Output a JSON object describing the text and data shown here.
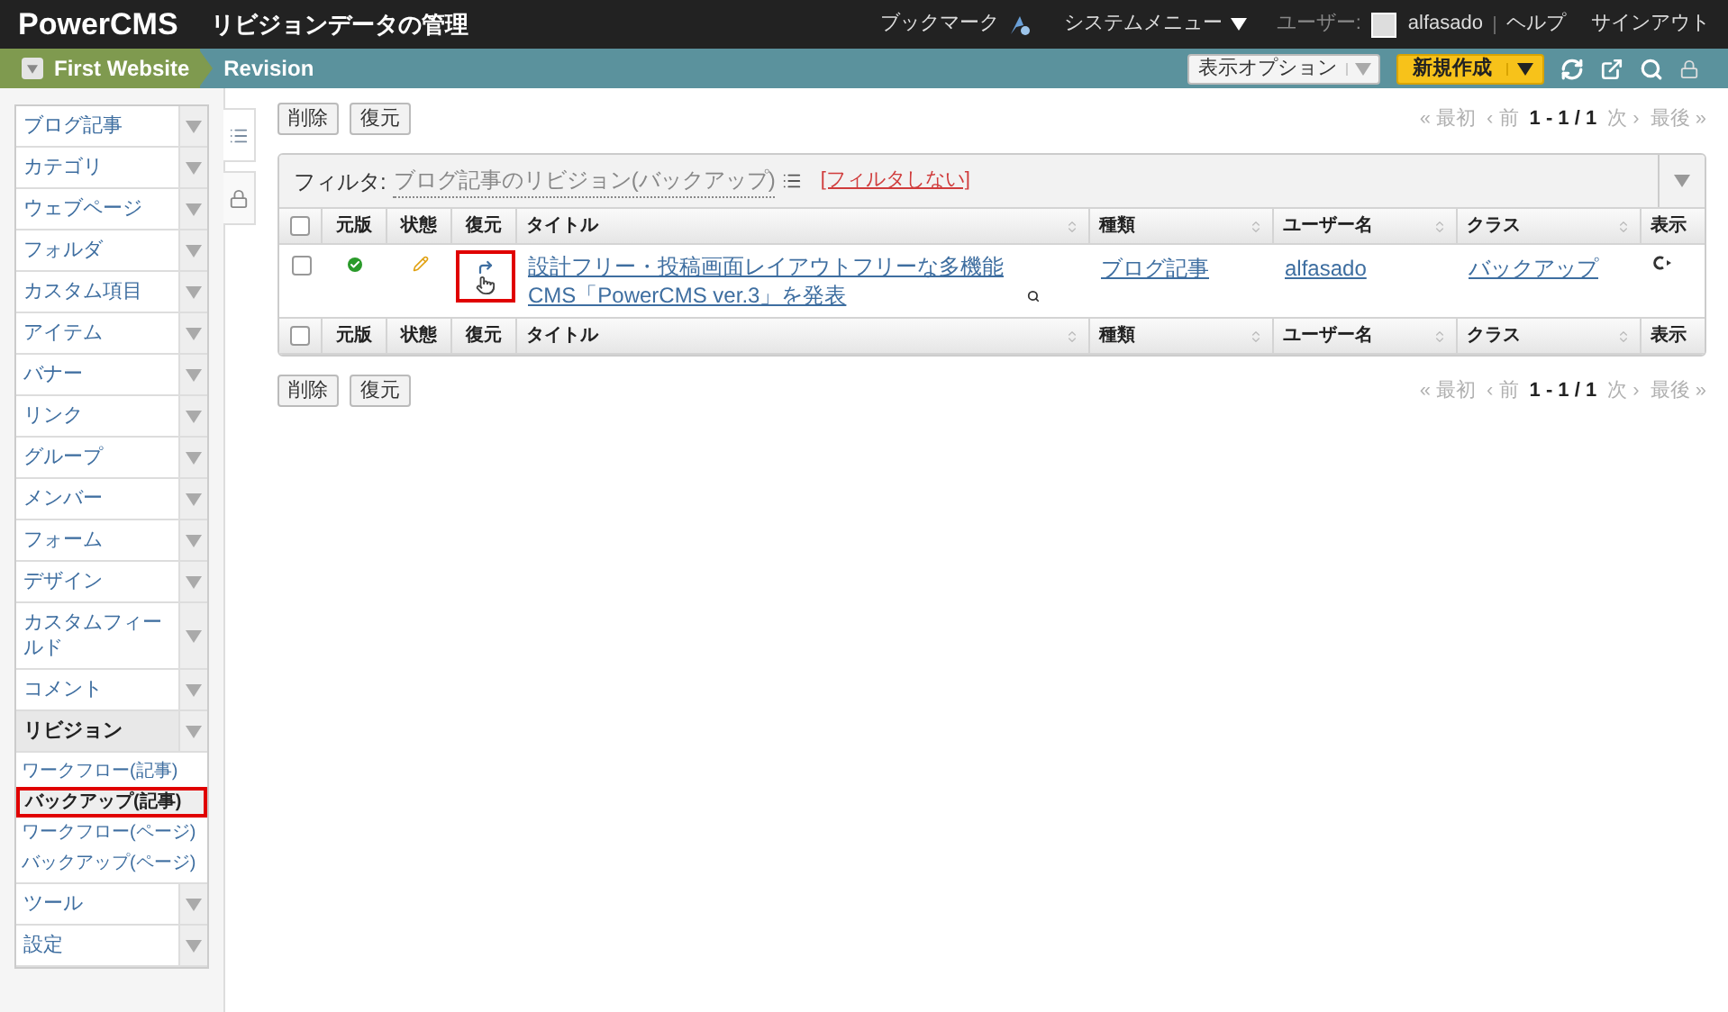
{
  "header": {
    "logo": "PowerCMS",
    "title": "リビジョンデータの管理",
    "bookmark": "ブックマーク",
    "system_menu": "システムメニュー",
    "user_label": "ユーザー:",
    "user": "alfasado",
    "help": "ヘルプ",
    "signout": "サインアウト"
  },
  "breadcrumb": {
    "site": "First Website",
    "page": "Revision"
  },
  "toolbar": {
    "display_options": "表示オプション",
    "new": "新規作成"
  },
  "sidebar": {
    "items": [
      {
        "label": "ブログ記事",
        "expanded": false
      },
      {
        "label": "カテゴリ",
        "expanded": false
      },
      {
        "label": "ウェブページ",
        "expanded": false
      },
      {
        "label": "フォルダ",
        "expanded": false
      },
      {
        "label": "カスタム項目",
        "expanded": false
      },
      {
        "label": "アイテム",
        "expanded": false
      },
      {
        "label": "バナー",
        "expanded": false
      },
      {
        "label": "リンク",
        "expanded": false
      },
      {
        "label": "グループ",
        "expanded": false
      },
      {
        "label": "メンバー",
        "expanded": false
      },
      {
        "label": "フォーム",
        "expanded": false
      },
      {
        "label": "デザイン",
        "expanded": false
      },
      {
        "label": "カスタムフィールド",
        "expanded": false
      },
      {
        "label": "コメント",
        "expanded": false
      },
      {
        "label": "リビジョン",
        "expanded": true,
        "children": [
          {
            "label": "ワークフロー(記事)",
            "selected": false
          },
          {
            "label": "バックアップ(記事)",
            "selected": true
          },
          {
            "label": "ワークフロー(ページ)",
            "selected": false
          },
          {
            "label": "バックアップ(ページ)",
            "selected": false
          }
        ]
      },
      {
        "label": "ツール",
        "expanded": false
      },
      {
        "label": "設定",
        "expanded": false
      }
    ]
  },
  "actions_top": [
    "削除",
    "復元"
  ],
  "pagination_top": {
    "first": "« 最初",
    "prev": "‹ 前",
    "range": "1 - 1 / 1",
    "next": "次 ›",
    "last": "最後 »"
  },
  "filter": {
    "label": "フィルタ:",
    "value": "ブログ記事のリビジョン(バックアップ)",
    "clear": "[フィルタしない]"
  },
  "table": {
    "columns": [
      {
        "kind": "check",
        "checked": false
      },
      {
        "kind": "center",
        "label": "元版"
      },
      {
        "kind": "center",
        "label": "状態"
      },
      {
        "kind": "center",
        "label": "復元"
      },
      {
        "kind": "sort",
        "label": "タイトル"
      },
      {
        "kind": "sort",
        "label": "種類"
      },
      {
        "kind": "sort",
        "label": "ユーザー名"
      },
      {
        "kind": "sort",
        "label": "クラス"
      },
      {
        "kind": "plain",
        "label": "表示"
      }
    ],
    "rows": [
      {
        "checked": false,
        "title": "設計フリー・投稿画面レイアウトフリーな多機能CMS「PowerCMS ver.3」を発表",
        "type": "ブログ記事",
        "user": "alfasado",
        "class": "バックアップ",
        "restore_highlighted": true
      }
    ],
    "footer_columns": [
      {
        "kind": "check",
        "checked": false
      },
      {
        "kind": "center",
        "label": "元版"
      },
      {
        "kind": "center",
        "label": "状態"
      },
      {
        "kind": "center",
        "label": "復元"
      },
      {
        "kind": "sort",
        "label": "タイトル"
      },
      {
        "kind": "sort",
        "label": "種類"
      },
      {
        "kind": "sort",
        "label": "ユーザー名"
      },
      {
        "kind": "sort",
        "label": "クラス"
      },
      {
        "kind": "plain",
        "label": "表示"
      }
    ]
  },
  "actions_bottom": [
    "削除",
    "復元"
  ],
  "pagination_bottom": {
    "first": "« 最初",
    "prev": "‹ 前",
    "range": "1 - 1 / 1",
    "next": "次 ›",
    "last": "最後 »"
  }
}
